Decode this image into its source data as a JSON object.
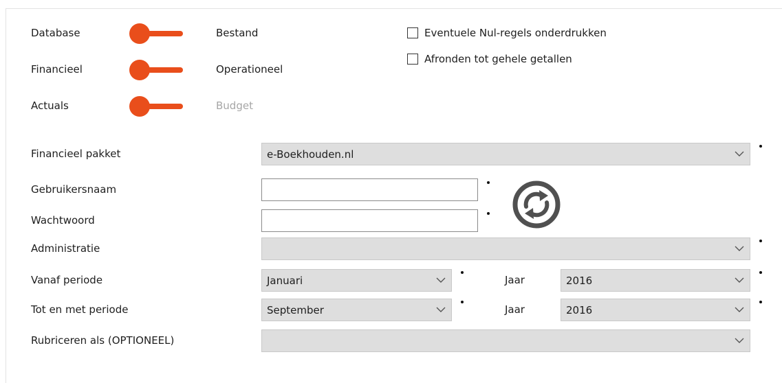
{
  "toggles": [
    {
      "left_label": "Database",
      "right_label": "Bestand"
    },
    {
      "left_label": "Financieel",
      "right_label": "Operationeel"
    },
    {
      "left_label": "Actuals",
      "right_label": "Budget"
    }
  ],
  "checkboxes": [
    {
      "label": "Eventuele Nul-regels onderdrukken",
      "checked": false
    },
    {
      "label": "Afronden tot gehele getallen",
      "checked": false
    }
  ],
  "form": {
    "package_label": "Financieel pakket",
    "package_value": "e-Boekhouden.nl",
    "username_label": "Gebruikersnaam",
    "username_value": "",
    "password_label": "Wachtwoord",
    "password_value": "",
    "administration_label": "Administratie",
    "administration_value": "",
    "from_period_label": "Vanaf periode",
    "from_period_value": "Januari",
    "from_year_label": "Jaar",
    "from_year_value": "2016",
    "to_period_label": "Tot en met periode",
    "to_period_value": "September",
    "to_year_label": "Jaar",
    "to_year_value": "2016",
    "classify_label": "Rubriceren als (OPTIONEEL)",
    "classify_value": ""
  },
  "icons": {
    "refresh": "refresh-icon",
    "dropdown": "chevron-down-icon"
  },
  "colors": {
    "accent": "#e94e1b",
    "select_bg": "#dedede",
    "muted_text": "#a6a6a6",
    "refresh_icon": "#505050"
  }
}
